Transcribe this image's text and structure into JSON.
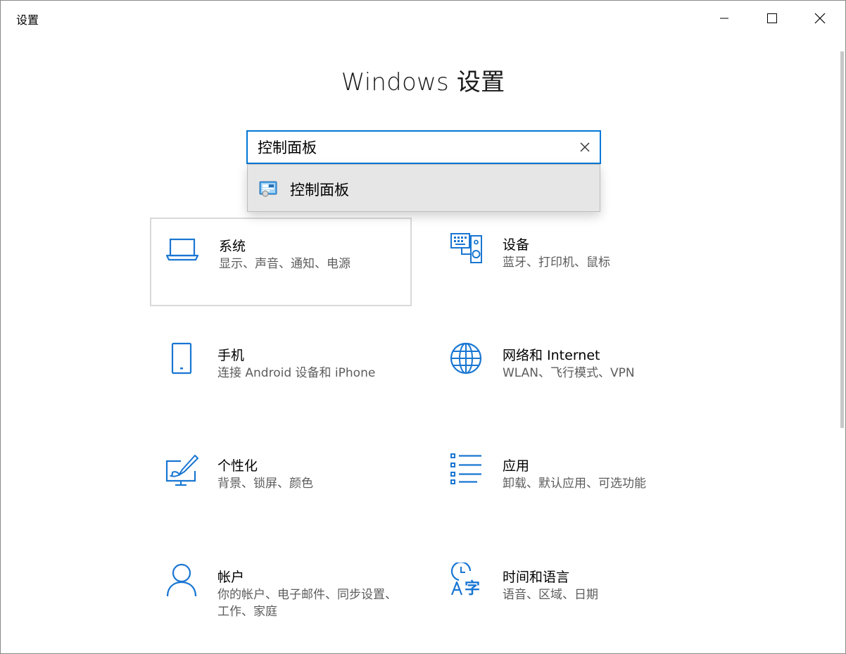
{
  "window": {
    "title": "设置"
  },
  "page": {
    "title": "Windows 设置"
  },
  "search": {
    "value": "控制面板",
    "placeholder": ""
  },
  "suggestions": [
    {
      "label": "控制面板",
      "icon": "control-panel-icon"
    }
  ],
  "tiles": [
    {
      "title": "系统",
      "desc": "显示、声音、通知、电源",
      "icon": "laptop-icon"
    },
    {
      "title": "设备",
      "desc": "蓝牙、打印机、鼠标",
      "icon": "devices-icon"
    },
    {
      "title": "手机",
      "desc": "连接 Android 设备和 iPhone",
      "icon": "phone-icon"
    },
    {
      "title": "网络和 Internet",
      "desc": "WLAN、飞行模式、VPN",
      "icon": "globe-icon"
    },
    {
      "title": "个性化",
      "desc": "背景、锁屏、颜色",
      "icon": "personalization-icon"
    },
    {
      "title": "应用",
      "desc": "卸载、默认应用、可选功能",
      "icon": "apps-list-icon"
    },
    {
      "title": "帐户",
      "desc": "你的帐户、电子邮件、同步设置、工作、家庭",
      "icon": "person-icon"
    },
    {
      "title": "时间和语言",
      "desc": "语音、区域、日期",
      "icon": "time-language-icon"
    }
  ],
  "colors": {
    "accent": "#0078d7",
    "icon_blue": "#1976d2",
    "secondary_text": "#5c5c5c"
  }
}
